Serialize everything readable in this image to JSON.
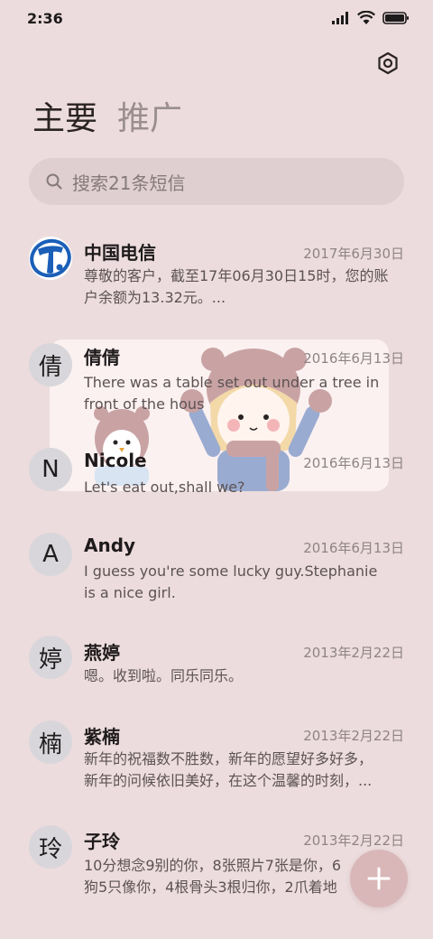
{
  "status_bar": {
    "time": "2:36",
    "icons": [
      "signal-icon",
      "wifi-icon",
      "battery-icon"
    ]
  },
  "header": {
    "settings_icon": "gear-icon",
    "tabs": [
      {
        "label": "主要",
        "active": true
      },
      {
        "label": "推广",
        "active": false
      }
    ]
  },
  "search": {
    "placeholder": "搜索21条短信",
    "icon": "search-icon"
  },
  "messages": [
    {
      "avatar": "",
      "avatar_icon": "china-telecom-logo",
      "sender": "中国电信",
      "date": "2017年6月30日",
      "preview_lines": [
        "尊敬的客户，截至17年06月30日15时，您的账",
        "户余额为13.32元。..."
      ]
    },
    {
      "avatar": "倩",
      "sender": "倩倩",
      "date": "2016年6月13日",
      "preview_lines": [
        "There was a table set out under a tree in",
        "front of the hous"
      ]
    },
    {
      "avatar": "N",
      "sender": "Nicole",
      "date": "2016年6月13日",
      "preview_lines": [
        "Let's eat out,shall we?"
      ]
    },
    {
      "avatar": "A",
      "sender": "Andy",
      "date": "2016年6月13日",
      "preview_lines": [
        "I guess you're some lucky guy.Stephanie",
        "is a nice girl."
      ]
    },
    {
      "avatar": "婷",
      "sender": "燕婷",
      "date": "2013年2月22日",
      "preview_lines": [
        "嗯。收到啦。同乐同乐。"
      ]
    },
    {
      "avatar": "楠",
      "sender": "紫楠",
      "date": "2013年2月22日",
      "preview_lines": [
        "新年的祝福数不胜数，新年的愿望好多好多，",
        "新年的问候依旧美好，在这个温馨的时刻，..."
      ]
    },
    {
      "avatar": "玲",
      "sender": "子玲",
      "date": "2013年2月22日",
      "preview_lines": [
        "10分想念9别的你，8张照片7张是你，6",
        "狗5只像你，4根骨头3根归你，2爪着地"
      ]
    }
  ],
  "fab": {
    "icon": "plus-icon"
  },
  "colors": {
    "background": "#ecdcdd",
    "search_bg": "#e0cfd0",
    "avatar_bg": "#d8d6da",
    "fab_bg": "#d9b7b8",
    "telecom_blue": "#1b5fb8"
  }
}
